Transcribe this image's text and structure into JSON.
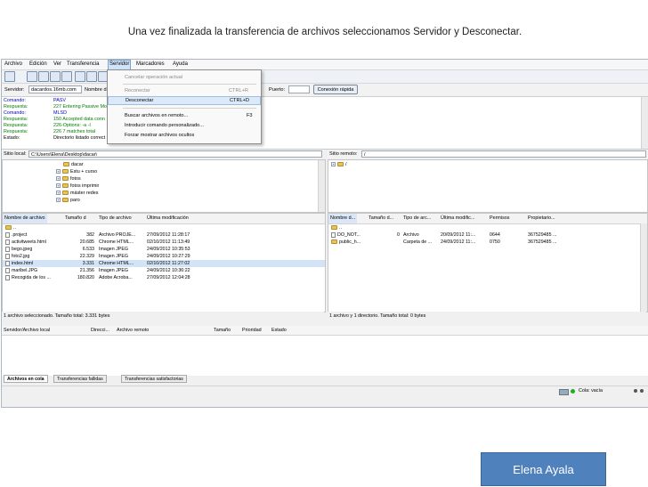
{
  "caption": "Una vez finalizada la transferencia de archivos seleccionamos Servidor y Desconectar.",
  "menubar": [
    "Archivo",
    "Edición",
    "Ver",
    "Transferencia",
    "Servidor",
    "Marcadores",
    "Ayuda"
  ],
  "quickconnect": {
    "server_label": "Servidor:",
    "server_value": "dacardos.16mb.com",
    "user_label": "Nombre d",
    "port_label": "Puerto:",
    "button": "Conexión rápida"
  },
  "server_menu": [
    {
      "label": "Cancelar operación actual",
      "shortcut": ""
    },
    {
      "label": "Reconectar",
      "shortcut": "CTRL+R"
    },
    {
      "label": "Desconectar",
      "shortcut": "CTRL+D"
    },
    {
      "label": "Buscar archivos en remoto...",
      "shortcut": "F3"
    },
    {
      "label": "Introducir comando personalizado...",
      "shortcut": ""
    },
    {
      "label": "Forzar mostrar archivos ocultos",
      "shortcut": ""
    }
  ],
  "log": [
    {
      "k": "Comando:",
      "v": "PASV"
    },
    {
      "k": "Respuesta:",
      "v": "227 Entering Passive Mo"
    },
    {
      "k": "Comando:",
      "v": "MLSD"
    },
    {
      "k": "Respuesta:",
      "v": "150 Accepted data conn"
    },
    {
      "k": "Respuesta:",
      "v": "226-Options: -a -l"
    },
    {
      "k": "Respuesta:",
      "v": "226 7 matches total"
    },
    {
      "k": "Estado:",
      "v": "Directorio listado correct"
    }
  ],
  "local": {
    "site_label": "Sitio local:",
    "site_value": "C:\\Users\\Elena\\Desktop\\dacar\\",
    "tree": [
      "dacar",
      "Estu + curso",
      "fotos",
      "fotos imprimir",
      "máster redes",
      "paro"
    ],
    "headers": [
      "Nombre de archivo",
      "Tamaño d",
      "Tipo de archivo",
      "Última modificación"
    ],
    "files": [
      {
        "name": "..",
        "size": "",
        "type": "",
        "date": ""
      },
      {
        "name": ".project",
        "size": "382",
        "type": "Archivo PROJE...",
        "date": "27/09/2012 11:28:17"
      },
      {
        "name": "activitweets.html",
        "size": "20.685",
        "type": "Chrome HTML...",
        "date": "02/10/2012 11:13:49"
      },
      {
        "name": "bego.jpeg",
        "size": "6.533",
        "type": "Imagen JPEG",
        "date": "24/09/2012 10:35:53"
      },
      {
        "name": "foto2.jpg",
        "size": "22.329",
        "type": "Imagen JPEG",
        "date": "24/09/2012 10:27:29"
      },
      {
        "name": "index.html",
        "size": "3.331",
        "type": "Chrome HTML...",
        "date": "02/10/2012 11:27:02"
      },
      {
        "name": "maribel.JPG",
        "size": "21.356",
        "type": "Imagen JPEG",
        "date": "24/09/2012 10:36:22"
      },
      {
        "name": "Recogida de los ...",
        "size": "180.820",
        "type": "Adobe Acroba...",
        "date": "27/09/2012 12:04:28"
      }
    ],
    "status": "1 archivo seleccionado. Tamaño total: 3.331 bytes"
  },
  "remote": {
    "site_label": "Sitio remoto:",
    "site_value": "/",
    "tree": [
      "/"
    ],
    "headers": [
      "Nombre d...",
      "Tamaño d...",
      "Tipo de arc...",
      "Última modific...",
      "Permisos",
      "Propietario..."
    ],
    "files": [
      {
        "name": "..",
        "size": "",
        "type": "",
        "date": "",
        "perm": "",
        "owner": ""
      },
      {
        "name": "DO_NOT...",
        "size": "0",
        "type": "Archivo",
        "date": "20/09/2012 11:...",
        "perm": "0644",
        "owner": "367529485 ..."
      },
      {
        "name": "public_h...",
        "size": "",
        "type": "Carpeta de ...",
        "date": "24/09/2012 11:...",
        "perm": "0750",
        "owner": "367529485 ..."
      }
    ],
    "status": "1 archivo y 1 directorio. Tamaño total: 0 bytes"
  },
  "queue": {
    "headers": [
      "Servidor/Archivo local",
      "Direcci...",
      "Archivo remoto",
      "Tamaño",
      "Prioridad",
      "Estado"
    ],
    "tabs": [
      "Archivos en cola",
      "Transferencias fallidas",
      "Transferencias satisfactorias"
    ],
    "status": "Cola: vacía"
  },
  "author": "Elena Ayala"
}
